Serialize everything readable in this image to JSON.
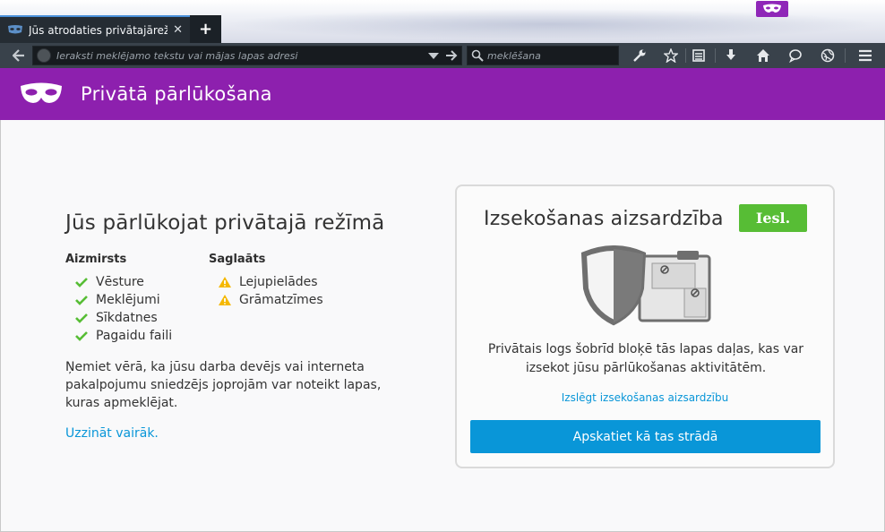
{
  "tab": {
    "title": "Jūs atrodaties privātajārežī...",
    "close_symbol": "✕",
    "new_tab_symbol": "+"
  },
  "navbar": {
    "url_placeholder": "Ieraksti meklējamo tekstu vai mājas lapas adresi",
    "search_placeholder": "meklēšana",
    "icons": [
      "back-arrow-icon",
      "dropdown-arrow-icon",
      "go-arrow-icon",
      "search-icon",
      "wrench-icon",
      "star-icon",
      "reading-list-icon",
      "download-icon",
      "home-icon",
      "chat-bubble-icon",
      "globe-icon",
      "hamburger-menu-icon"
    ]
  },
  "header": {
    "title": "Privātā pārlūkošana"
  },
  "main": {
    "heading": "Jūs pārlūkojat privātajā režīmā",
    "forgotten": {
      "title": "Aizmirsts",
      "items": [
        "Vēsture",
        "Meklējumi",
        "Sīkdatnes",
        "Pagaidu faili"
      ]
    },
    "saved": {
      "title": "Saglaāts",
      "items": [
        "Lejupielādes",
        "Grāmatzīmes"
      ]
    },
    "note": "Ņemiet vērā, ka jūsu darba devējs vai interneta pakalpojumu sniedzējs joprojām var noteikt lapas, kuras apmeklējat.",
    "learn_more": "Uzzināt vairāk."
  },
  "tracking": {
    "title": "Izsekošanas aizsardzība",
    "status": "Iesl.",
    "description": "Privātais logs šobrīd bloķē tās lapas daļas, kas var izsekot jūsu pārlūkošanas aktivitātēm.",
    "disable_link": "Izslēgt izsekošanas aizsardzību",
    "button": "Apskatiet kā tas strādā"
  },
  "colors": {
    "purple": "#8d20ae",
    "green": "#57bd35",
    "blue": "#0996d8",
    "warning": "#f5b800"
  }
}
